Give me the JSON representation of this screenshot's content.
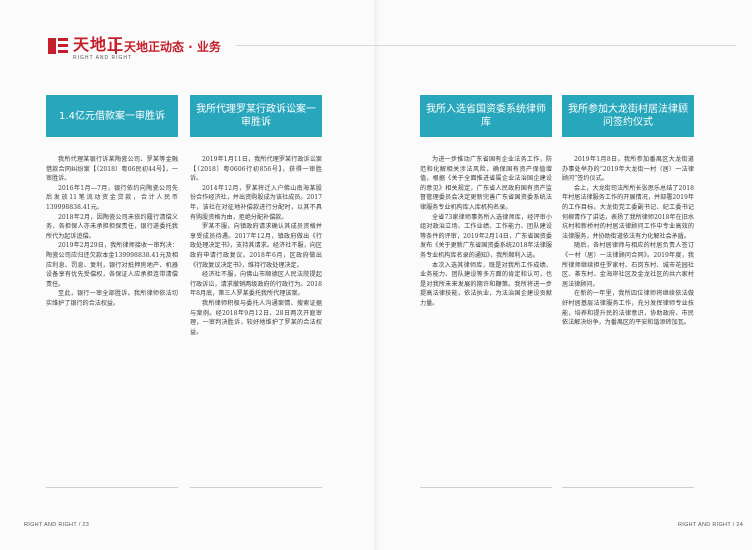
{
  "header": {
    "logo_cn": "天地正",
    "logo_en": "RIGHT AND RIGHT",
    "title": "天地正动态 · 业务"
  },
  "articles": [
    {
      "title": "1.4亿元借款案一审胜诉",
      "paragraphs": [
        "我所代理某银行诉某陶瓷公司、罗某等金融借款合同纠纷案【（2018）粤06民初44号】，一审胜诉。",
        "2016年1月—7月，银行依约向陶瓷公司先后发放11笔流动资金贷款，合计人民币139998838.41元。",
        "2018年2月，因陶瓷公司未依约履行清偿义务，各担保人亦未承担担保责任，银行遂委托我所代为起诉追偿。",
        "2019年2月29日，我所律师接收一审判决：陶瓷公司应归还欠款本金139998838.41元及相应利息、罚息、复利，银行对抵押房地产、机器设备享有优先受偿权，各保证人应承担连带清偿责任。",
        "至此，银行一审全部胜诉。我所律师依法切实维护了银行的合法权益。"
      ]
    },
    {
      "title": "我所代理罗某行政诉讼案一审胜诉",
      "paragraphs": [
        "2019年1月11日，我所代理罗某行政诉讼案【（2018）粤0606行初856号】，获得一审胜诉。",
        "2014年12月，罗某将迁入户佛山南海某股份合作经济社，并出资购股成为该社成员。2017年，该社在对征地补偿款进行分配时，以其不具有购股资格为由，拒绝分配补偿款。",
        "罗某不服，向镇政府请求确认其成员资格并享受成员待遇。2017年12月，镇政府做出《行政处理决定书》，支持其请求。经济社不服，向区政府申请行政复议。2018年6月，区政府做出《行政复议决定书》，维持行政处理决定。",
        "经济社不服，向佛山市顺德区人民法院提起行政诉讼，请求撤销两级政府的行政行为。2018年8月底，第三人罗某委托我所代理该案。",
        "我所律师积极与委托人沟通案情、搜索证据与案例。经2018年9月12日、28日两次开庭审理，一审判决胜诉，较好地维护了罗某的合法权益。"
      ]
    },
    {
      "title": "我所入选省国资委系统律师库",
      "paragraphs": [
        "为进一步推动广东省国有企业法务工作，防范和化解相关涉法风险，确保国有资产保值增值，根据《关于全面推进省属企业法治国企建设的意见》相关规定，广东省人民政府国有资产监督管理委员会决定更新完善广东省国资委系统法律服务专业机构库入库机构名录。",
        "全省73家律师事务所入选律师库，经评审小组对政治立场、工作业绩、工作能力、团队建设等条件的评审，2019年2月14日，广东省国资委发布《关于更新广东省国资委系统2018年法律服务专业机构库名录的通知》，我所顺利入选。",
        "本次入选其律师库，既是对我所工作成绩、业务能力、团队建设等多方面的肯定和认可，也是对我所未来发展的期许和鞭策。我所将进一步提高法律技能，依法执业，为法治国企建设贡献力量。"
      ]
    },
    {
      "title": "我所参加大龙街村居法律顾问签约仪式",
      "paragraphs": [
        "2019年1月8日，我所参加番禺区大龙街道办事处举办的“2019年大龙街一村（居）一法律顾问”签约仪式。",
        "会上，大龙街司法所所长张思乐总结了2018年村居法律服务工作的开展情况，并部署2019年的工作目标。大龙街党工委副书记、纪工委书记何柳青作了讲话，表扬了我所律师2018年在旧水坑村和新桥村的村居法律顾问工作中专业高效的法律服务，并协助街道依法有力化解社会矛盾。",
        "随后，各村居律师与相应的村居负责人签订《一村（居）一法律顾问合同》。2019年度，我所律师继续担任罗家村、石岗东村、城市花园社区、茶东村、金海岸社区及金龙社区的共六家村居法律顾问。",
        "在新的一年里，我所四位律师将继续依法做好村居基层法律服务工作，充分发挥律师专业技能，培养和提升民的法律意识，协助政府、市民依法解决纷争，为番禺区的平安和谐添砖加瓦。"
      ]
    }
  ],
  "footer": {
    "left": "RIGHT AND RIGHT / 23",
    "right": "RIGHT AND RIGHT / 24"
  }
}
